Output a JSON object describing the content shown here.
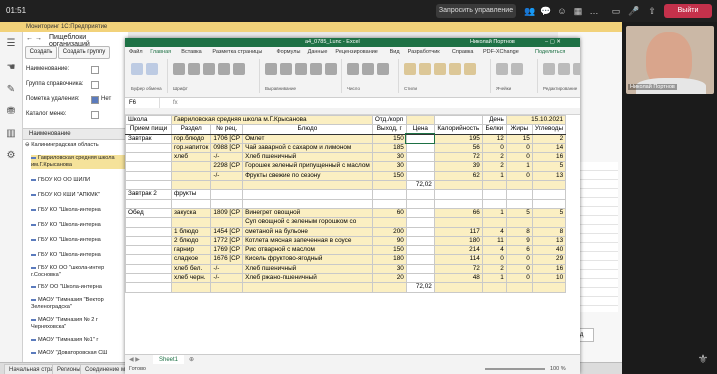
{
  "teams": {
    "time": "01:51",
    "request_control": "Запросить управление",
    "leave": "Выйти",
    "presenter_name": "Николай Портнов"
  },
  "onec": {
    "title": "Мониторинг 1С:Предприятие",
    "panel_title": "Пищеблоки организаций",
    "create_label": "Создать",
    "create_group_label": "Создать группу",
    "filters": [
      {
        "label": "Наименование:",
        "value": ""
      },
      {
        "label": "Группа справочника:",
        "value": ""
      },
      {
        "label": "Пометка удаления:",
        "value": "Нет"
      },
      {
        "label": "Каталог меню:",
        "value": ""
      }
    ],
    "column_header": "Наименование",
    "tree": [
      "Калининградская область",
      "Гавриловская средняя школа им.Г.Крысанова",
      "ГБОУ КО ОО ШИЛИ",
      "ГБОУ КО КШИ \"АПКМК\"",
      "ГБУ КО \"Школа-интерна",
      "ГБУ КО \"Школа-интерна",
      "ГБУ КО \"Школа-интерна",
      "ГБУ КО \"Школа-интерна",
      "ГБУ КО ОО \"школа-интер г.Сосновка\"",
      "ГБУ ОО \"Школа-интерна",
      "МАОУ \"Гимназия \"Вектор Зеленоградска\"",
      "МАОУ \"Гимназия № 2 г Черняховска\"",
      "МАОУ \"Гимназия №1\" г",
      "МАОУ \"Доваторовская СШ"
    ],
    "status_tabs": [
      "Начальная страница",
      "Регионы",
      "Соединение массы"
    ],
    "right_button": "Вид"
  },
  "excel": {
    "filename": "a4_0785_Lunc - Excel",
    "user": "Николай Портнов",
    "share": "Поделиться",
    "tabs": [
      "Файл",
      "Главная",
      "Вставка",
      "Разметка страницы",
      "Формулы",
      "Данные",
      "Рецензирование",
      "Вид",
      "Разработчик",
      "Справка",
      "PDF-XChange"
    ],
    "name_box": "F6",
    "sheet_tab": "Sheet1",
    "status": "Готово",
    "zoom": "100 %",
    "ribbon_groups": [
      "Буфер обмена",
      "Шрифт",
      "Выравнивание",
      "Число",
      "Стили",
      "Ячейки",
      "Редактирование"
    ],
    "header_row": {
      "school_label": "Школа",
      "school": "Гавриловская средняя школа м.Г.Крысанова",
      "dept": "Отд./корп",
      "day_label": "День",
      "date": "15.10.2021"
    },
    "columns": [
      "Прием пищи",
      "Раздел",
      "№ рец.",
      "Блюдо",
      "Выход, г",
      "Цена",
      "Калорийность",
      "Белки",
      "Жиры",
      "Углеводы"
    ],
    "rows": [
      [
        "Завтрак",
        "гор.блюдо",
        "1706 [СР",
        "Омлет",
        "150",
        "",
        "195",
        "12",
        "15",
        "2"
      ],
      [
        "",
        "гор.напиток",
        "0988 [СР",
        "Чай заварной с сахаром и лимоном",
        "185",
        "",
        "56",
        "0",
        "0",
        "14"
      ],
      [
        "",
        "хлеб",
        "-/-",
        "Хлеб пшеничный",
        "30",
        "",
        "72",
        "2",
        "0",
        "16"
      ],
      [
        "",
        "",
        "2298 [СР",
        "Горошек зеленый припущенный с маслом",
        "30",
        "",
        "39",
        "2",
        "1",
        "5"
      ],
      [
        "",
        "",
        "-/-",
        "Фрукты свежие по сезону",
        "150",
        "",
        "62",
        "1",
        "0",
        "13"
      ],
      [
        "",
        "",
        "",
        "",
        "",
        "72,02",
        "",
        "",
        "",
        ""
      ],
      [
        "Завтрак 2",
        "фрукты",
        "",
        "",
        "",
        "",
        "",
        "",
        "",
        ""
      ],
      [
        "",
        "",
        "",
        "",
        "",
        "",
        "",
        "",
        "",
        ""
      ],
      [
        "Обед",
        "закуска",
        "1809 [СР",
        "Винегрет овощной",
        "60",
        "",
        "66",
        "1",
        "5",
        "5"
      ],
      [
        "",
        "",
        "",
        "Суп овощной с зеленым горошком со",
        "",
        "",
        "",
        "",
        "",
        ""
      ],
      [
        "",
        "1 блюдо",
        "1454 [СР",
        "сметаной на бульоне",
        "200",
        "",
        "117",
        "4",
        "8",
        "8"
      ],
      [
        "",
        "2 блюдо",
        "1772 [СР",
        "Котлета мясная запеченная в соусе",
        "90",
        "",
        "180",
        "11",
        "9",
        "13"
      ],
      [
        "",
        "гарнир",
        "1769 [СР",
        "Рис отварной с маслом",
        "150",
        "",
        "214",
        "4",
        "6",
        "40"
      ],
      [
        "",
        "сладкое",
        "1676 [СР",
        "Кисель фруктово-ягодный",
        "180",
        "",
        "114",
        "0",
        "0",
        "29"
      ],
      [
        "",
        "хлеб бел.",
        "-/-",
        "Хлеб пшеничный",
        "30",
        "",
        "72",
        "2",
        "0",
        "16"
      ],
      [
        "",
        "хлеб черн.",
        "-/-",
        "Хлеб ржано-пшеничный",
        "20",
        "",
        "48",
        "1",
        "0",
        "10"
      ],
      [
        "",
        "",
        "",
        "",
        "",
        "72,02",
        "",
        "",
        "",
        ""
      ]
    ]
  },
  "colors": {
    "excel_green": "#1e7145",
    "cell_yellow": "#fbefc2",
    "leave_red": "#c4314b",
    "onec_yellow": "#f2d27a"
  }
}
